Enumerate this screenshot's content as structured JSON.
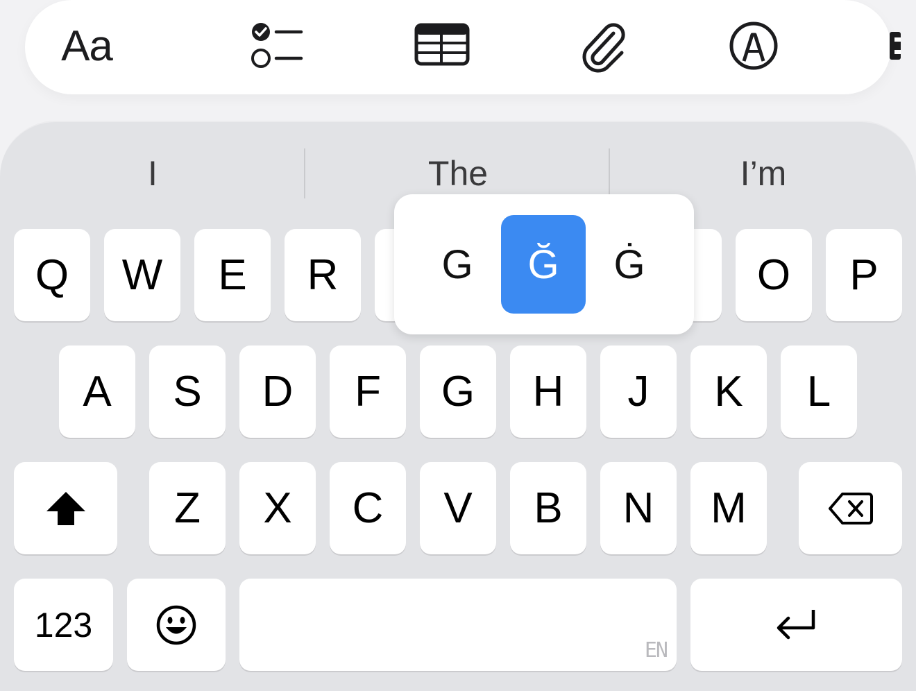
{
  "toolbar": {
    "format_label": "Aa",
    "icons": [
      "checklist-icon",
      "table-icon",
      "paperclip-icon",
      "markup-pen-icon",
      "more-tools-icon"
    ]
  },
  "suggestions": [
    "I",
    "The",
    "I’m"
  ],
  "keys": {
    "row1": [
      "Q",
      "W",
      "E",
      "R",
      "O",
      "P"
    ],
    "row2": [
      "A",
      "S",
      "D",
      "F",
      "G",
      "H",
      "J",
      "K",
      "L"
    ],
    "row3": [
      "Z",
      "X",
      "C",
      "V",
      "B",
      "N",
      "M"
    ],
    "numbers_label": "123",
    "space_language": "EN"
  },
  "accent_popover": {
    "options": [
      "G",
      "Ğ",
      "Ġ"
    ],
    "selected_index": 1
  },
  "colors": {
    "selected_accent": "#3b8af2",
    "keyboard_bg": "#e2e3e6",
    "key_bg": "#ffffff"
  }
}
